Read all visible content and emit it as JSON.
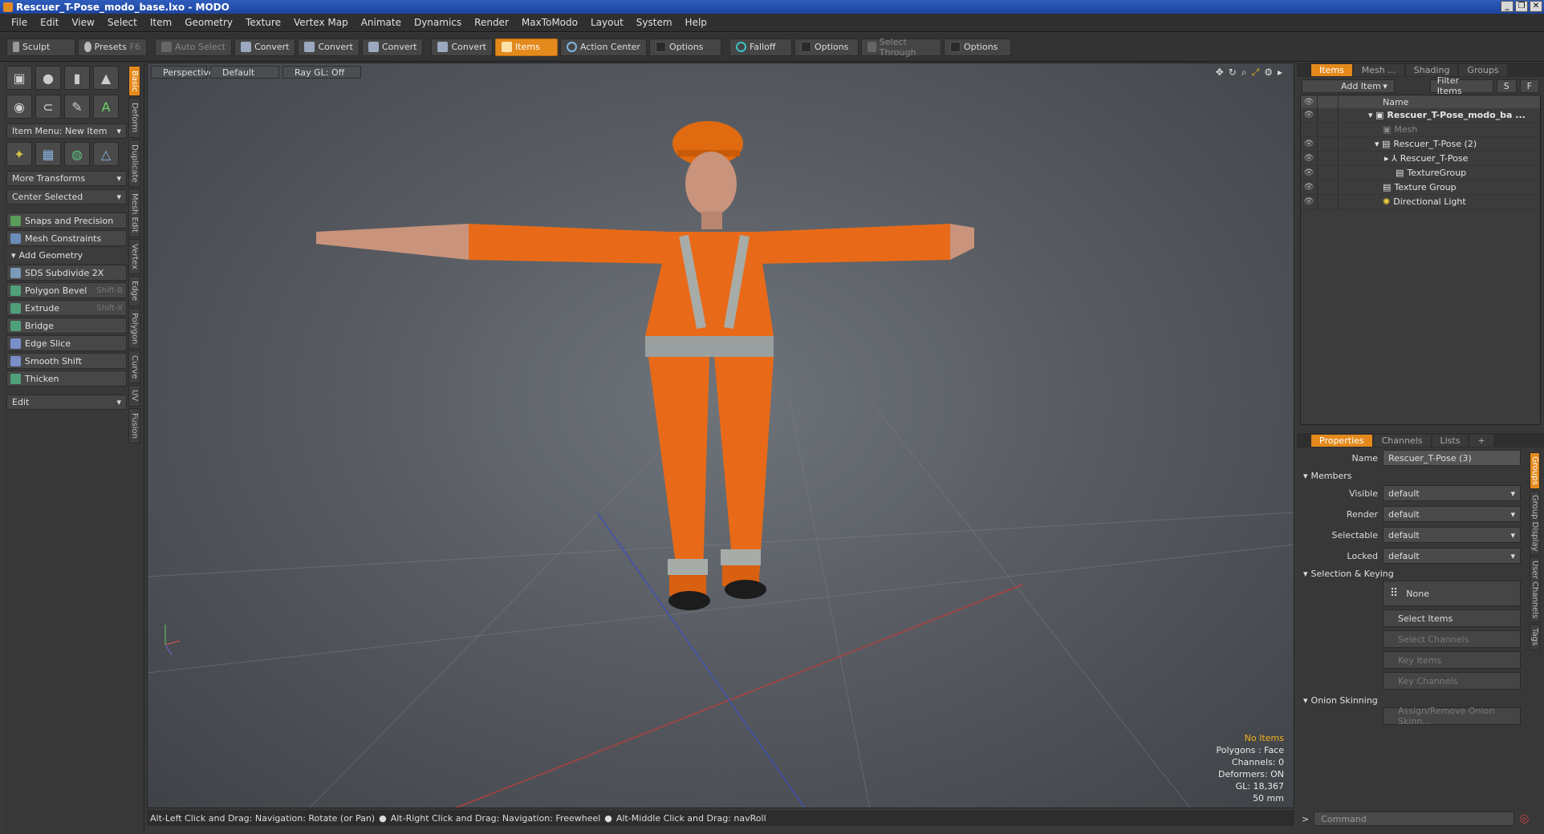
{
  "window": {
    "title": "Rescuer_T-Pose_modo_base.lxo - MODO"
  },
  "menu": [
    "File",
    "Edit",
    "View",
    "Select",
    "Item",
    "Geometry",
    "Texture",
    "Vertex Map",
    "Animate",
    "Dynamics",
    "Render",
    "MaxToModo",
    "Layout",
    "System",
    "Help"
  ],
  "toolbar": {
    "sculpt": "Sculpt",
    "presets": "Presets",
    "presets_key": "F6",
    "auto_select": "Auto Select",
    "convert1": "Convert",
    "convert2": "Convert",
    "convert3": "Convert",
    "convert4": "Convert",
    "items": "Items",
    "action_center": "Action Center",
    "options1": "Options",
    "falloff": "Falloff",
    "options2": "Options",
    "select_through": "Select Through",
    "options3": "Options"
  },
  "left": {
    "item_menu": "Item Menu: New Item",
    "more_transforms": "More Transforms",
    "center_selected": "Center Selected",
    "snaps": "Snaps and Precision",
    "mesh_constraints": "Mesh Constraints",
    "add_geometry": "Add Geometry",
    "tools": [
      {
        "label": "SDS Subdivide 2X",
        "shortcut": ""
      },
      {
        "label": "Polygon Bevel",
        "shortcut": "Shift-B"
      },
      {
        "label": "Extrude",
        "shortcut": "Shift-X"
      },
      {
        "label": "Bridge",
        "shortcut": ""
      },
      {
        "label": "Edge Slice",
        "shortcut": ""
      },
      {
        "label": "Smooth Shift",
        "shortcut": ""
      },
      {
        "label": "Thicken",
        "shortcut": ""
      }
    ],
    "edit": "Edit",
    "vtabs": [
      "Basic",
      "Deform",
      "Duplicate",
      "Mesh Edit",
      "Vertex",
      "Edge",
      "Polygon",
      "Curve",
      "UV",
      "Fusion"
    ]
  },
  "viewport": {
    "perspective": "Perspective",
    "default": "Default",
    "raygl": "Ray GL: Off",
    "info": {
      "items": "No Items",
      "polygons": "Polygons : Face",
      "channels": "Channels: 0",
      "deformers": "Deformers: ON",
      "gl": "GL: 18,367",
      "focal": "50 mm"
    }
  },
  "status": {
    "hint1": "Alt-Left Click and Drag: Navigation: Rotate (or Pan)",
    "hint2": "Alt-Right Click and Drag: Navigation: Freewheel",
    "hint3": "Alt-Middle Click and Drag: navRoll"
  },
  "items_panel": {
    "tabs": [
      "Items",
      "Mesh ...",
      "Shading",
      "Groups"
    ],
    "add_item": "Add Item",
    "filter": "Filter Items",
    "s": "S",
    "f": "F",
    "col_name": "Name",
    "rows": [
      {
        "label": "Rescuer_T-Pose_modo_ba ...",
        "bold": true,
        "indent": 0
      },
      {
        "label": "Mesh",
        "dim": true,
        "indent": 1
      },
      {
        "label": "Rescuer_T-Pose (2)",
        "indent": 1
      },
      {
        "label": "Rescuer_T-Pose",
        "indent": 2
      },
      {
        "label": "TextureGroup",
        "indent": 2
      },
      {
        "label": "Texture Group",
        "indent": 1
      },
      {
        "label": "Directional Light",
        "indent": 1
      }
    ]
  },
  "props": {
    "tabs": [
      "Properties",
      "Channels",
      "Lists",
      "+"
    ],
    "name_label": "Name",
    "name_value": "Rescuer_T-Pose (3)",
    "members": "Members",
    "visible": "Visible",
    "render": "Render",
    "selectable": "Selectable",
    "locked": "Locked",
    "default": "default",
    "sel_keying": "Selection & Keying",
    "none": "None",
    "select_items": "Select Items",
    "select_channels": "Select Channels",
    "key_items": "Key Items",
    "key_channels": "Key Channels",
    "onion": "Onion Skinning",
    "assign": "Assign/Remove Onion Skinn...",
    "vtabs": [
      "Groups",
      "Group Display",
      "User Channels",
      "Tags"
    ]
  },
  "command": {
    "placeholder": "Command"
  }
}
